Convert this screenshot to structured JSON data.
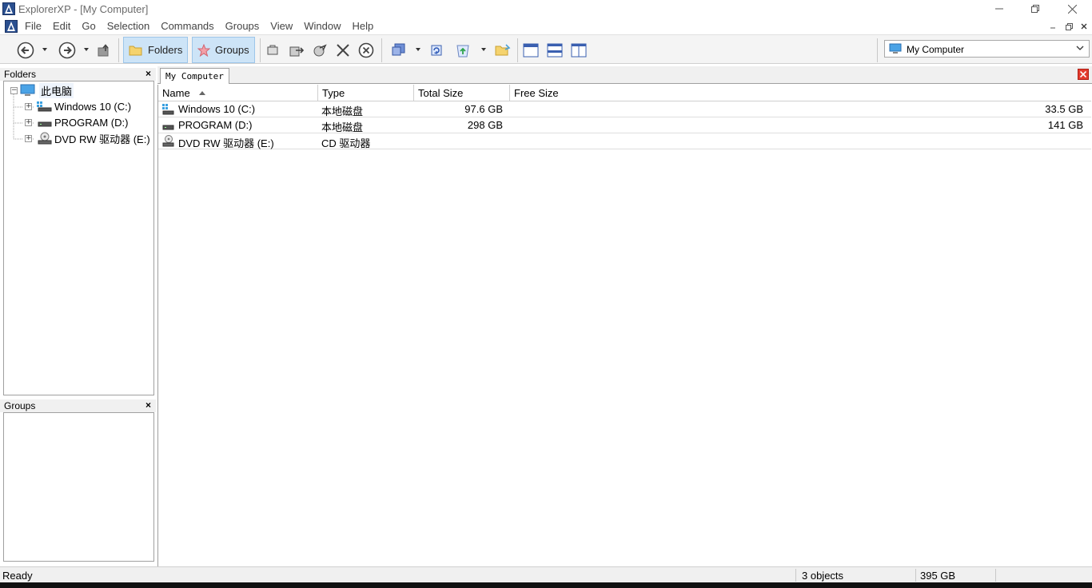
{
  "window": {
    "title": "ExplorerXP - [My Computer]"
  },
  "menu": [
    "File",
    "Edit",
    "Go",
    "Selection",
    "Commands",
    "Groups",
    "View",
    "Window",
    "Help"
  ],
  "toolbar": {
    "folders_label": "Folders",
    "groups_label": "Groups",
    "address_value": "My Computer"
  },
  "folders_pane": {
    "title": "Folders",
    "close": "×",
    "root": "此电脑",
    "children": [
      "Windows 10 (C:)",
      "PROGRAM (D:)",
      "DVD RW 驱动器 (E:)"
    ]
  },
  "groups_pane": {
    "title": "Groups",
    "close": "×"
  },
  "tab": {
    "label": "My Computer"
  },
  "list": {
    "columns": [
      "Name",
      "Type",
      "Total Size",
      "Free Size"
    ],
    "rows": [
      {
        "name": "Windows 10 (C:)",
        "type": "本地磁盘",
        "total": "97.6 GB",
        "free": "33.5 GB"
      },
      {
        "name": "PROGRAM (D:)",
        "type": "本地磁盘",
        "total": "298 GB",
        "free": "141 GB"
      },
      {
        "name": "DVD RW 驱动器 (E:)",
        "type": "CD 驱动器",
        "total": "",
        "free": ""
      }
    ]
  },
  "status": {
    "left": "Ready",
    "count": "3 objects",
    "size": "395 GB"
  }
}
